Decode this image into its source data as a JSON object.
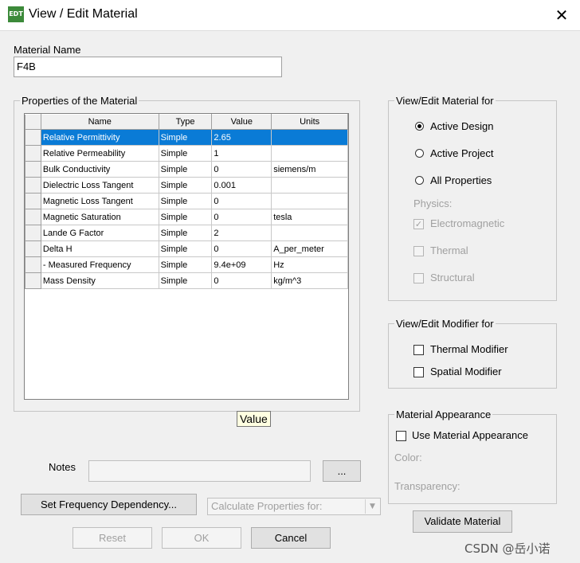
{
  "window": {
    "title": "View / Edit Material",
    "app_icon_text": "EDT",
    "close_glyph": "✕"
  },
  "material": {
    "name_label": "Material Name",
    "name_value": "F4B"
  },
  "properties": {
    "group_label": "Properties of the Material",
    "columns": [
      "Name",
      "Type",
      "Value",
      "Units"
    ],
    "rows": [
      {
        "name": "Relative Permittivity",
        "type": "Simple",
        "value": "2.65",
        "units": ""
      },
      {
        "name": "Relative Permeability",
        "type": "Simple",
        "value": "1",
        "units": ""
      },
      {
        "name": "Bulk Conductivity",
        "type": "Simple",
        "value": "0",
        "units": "siemens/m"
      },
      {
        "name": "Dielectric Loss Tangent",
        "type": "Simple",
        "value": "0.001",
        "units": ""
      },
      {
        "name": "Magnetic Loss Tangent",
        "type": "Simple",
        "value": "0",
        "units": ""
      },
      {
        "name": "Magnetic Saturation",
        "type": "Simple",
        "value": "0",
        "units": "tesla"
      },
      {
        "name": "Lande G Factor",
        "type": "Simple",
        "value": "2",
        "units": ""
      },
      {
        "name": "Delta H",
        "type": "Simple",
        "value": "0",
        "units": "A_per_meter"
      },
      {
        "name": "- Measured Frequency",
        "type": "Simple",
        "value": "9.4e+09",
        "units": "Hz"
      },
      {
        "name": "Mass Density",
        "type": "Simple",
        "value": "0",
        "units": "kg/m^3"
      }
    ],
    "tooltip": "Value"
  },
  "view_edit_for": {
    "label": "View/Edit Material for",
    "options": [
      "Active Design",
      "Active Project",
      "All Properties"
    ],
    "selected": "Active Design",
    "physics_label": "Physics:",
    "physics": [
      {
        "label": "Electromagnetic",
        "checked": true,
        "mark": "✓"
      },
      {
        "label": "Thermal",
        "checked": false,
        "mark": ""
      },
      {
        "label": "Structural",
        "checked": false,
        "mark": ""
      }
    ]
  },
  "modifier_for": {
    "label": "View/Edit Modifier for",
    "thermal": "Thermal Modifier",
    "spatial": "Spatial Modifier"
  },
  "appearance": {
    "label": "Material Appearance",
    "use_label": "Use Material Appearance",
    "color_label": "Color:",
    "transparency_label": "Transparency:"
  },
  "notes": {
    "label": "Notes",
    "value": "",
    "browse_label": "..."
  },
  "buttons": {
    "set_freq": "Set Frequency Dependency...",
    "calc_props": "Calculate Properties for:",
    "reset": "Reset",
    "ok": "OK",
    "cancel": "Cancel",
    "validate": "Validate Material"
  },
  "dropdown_arrow": "▼",
  "watermark": "CSDN @岳小诺",
  "colors": {
    "selection": "#0a7bd6",
    "tooltip_bg": "#ffffe1"
  }
}
